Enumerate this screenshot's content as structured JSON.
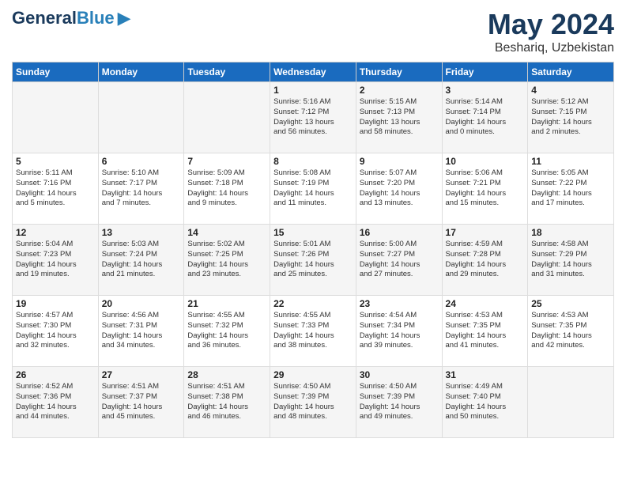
{
  "header": {
    "logo_line1": "General",
    "logo_line2": "Blue",
    "month_year": "May 2024",
    "location": "Beshariq, Uzbekistan"
  },
  "days_of_week": [
    "Sunday",
    "Monday",
    "Tuesday",
    "Wednesday",
    "Thursday",
    "Friday",
    "Saturday"
  ],
  "weeks": [
    [
      {
        "day": "",
        "content": ""
      },
      {
        "day": "",
        "content": ""
      },
      {
        "day": "",
        "content": ""
      },
      {
        "day": "1",
        "content": "Sunrise: 5:16 AM\nSunset: 7:12 PM\nDaylight: 13 hours\nand 56 minutes."
      },
      {
        "day": "2",
        "content": "Sunrise: 5:15 AM\nSunset: 7:13 PM\nDaylight: 13 hours\nand 58 minutes."
      },
      {
        "day": "3",
        "content": "Sunrise: 5:14 AM\nSunset: 7:14 PM\nDaylight: 14 hours\nand 0 minutes."
      },
      {
        "day": "4",
        "content": "Sunrise: 5:12 AM\nSunset: 7:15 PM\nDaylight: 14 hours\nand 2 minutes."
      }
    ],
    [
      {
        "day": "5",
        "content": "Sunrise: 5:11 AM\nSunset: 7:16 PM\nDaylight: 14 hours\nand 5 minutes."
      },
      {
        "day": "6",
        "content": "Sunrise: 5:10 AM\nSunset: 7:17 PM\nDaylight: 14 hours\nand 7 minutes."
      },
      {
        "day": "7",
        "content": "Sunrise: 5:09 AM\nSunset: 7:18 PM\nDaylight: 14 hours\nand 9 minutes."
      },
      {
        "day": "8",
        "content": "Sunrise: 5:08 AM\nSunset: 7:19 PM\nDaylight: 14 hours\nand 11 minutes."
      },
      {
        "day": "9",
        "content": "Sunrise: 5:07 AM\nSunset: 7:20 PM\nDaylight: 14 hours\nand 13 minutes."
      },
      {
        "day": "10",
        "content": "Sunrise: 5:06 AM\nSunset: 7:21 PM\nDaylight: 14 hours\nand 15 minutes."
      },
      {
        "day": "11",
        "content": "Sunrise: 5:05 AM\nSunset: 7:22 PM\nDaylight: 14 hours\nand 17 minutes."
      }
    ],
    [
      {
        "day": "12",
        "content": "Sunrise: 5:04 AM\nSunset: 7:23 PM\nDaylight: 14 hours\nand 19 minutes."
      },
      {
        "day": "13",
        "content": "Sunrise: 5:03 AM\nSunset: 7:24 PM\nDaylight: 14 hours\nand 21 minutes."
      },
      {
        "day": "14",
        "content": "Sunrise: 5:02 AM\nSunset: 7:25 PM\nDaylight: 14 hours\nand 23 minutes."
      },
      {
        "day": "15",
        "content": "Sunrise: 5:01 AM\nSunset: 7:26 PM\nDaylight: 14 hours\nand 25 minutes."
      },
      {
        "day": "16",
        "content": "Sunrise: 5:00 AM\nSunset: 7:27 PM\nDaylight: 14 hours\nand 27 minutes."
      },
      {
        "day": "17",
        "content": "Sunrise: 4:59 AM\nSunset: 7:28 PM\nDaylight: 14 hours\nand 29 minutes."
      },
      {
        "day": "18",
        "content": "Sunrise: 4:58 AM\nSunset: 7:29 PM\nDaylight: 14 hours\nand 31 minutes."
      }
    ],
    [
      {
        "day": "19",
        "content": "Sunrise: 4:57 AM\nSunset: 7:30 PM\nDaylight: 14 hours\nand 32 minutes."
      },
      {
        "day": "20",
        "content": "Sunrise: 4:56 AM\nSunset: 7:31 PM\nDaylight: 14 hours\nand 34 minutes."
      },
      {
        "day": "21",
        "content": "Sunrise: 4:55 AM\nSunset: 7:32 PM\nDaylight: 14 hours\nand 36 minutes."
      },
      {
        "day": "22",
        "content": "Sunrise: 4:55 AM\nSunset: 7:33 PM\nDaylight: 14 hours\nand 38 minutes."
      },
      {
        "day": "23",
        "content": "Sunrise: 4:54 AM\nSunset: 7:34 PM\nDaylight: 14 hours\nand 39 minutes."
      },
      {
        "day": "24",
        "content": "Sunrise: 4:53 AM\nSunset: 7:35 PM\nDaylight: 14 hours\nand 41 minutes."
      },
      {
        "day": "25",
        "content": "Sunrise: 4:53 AM\nSunset: 7:35 PM\nDaylight: 14 hours\nand 42 minutes."
      }
    ],
    [
      {
        "day": "26",
        "content": "Sunrise: 4:52 AM\nSunset: 7:36 PM\nDaylight: 14 hours\nand 44 minutes."
      },
      {
        "day": "27",
        "content": "Sunrise: 4:51 AM\nSunset: 7:37 PM\nDaylight: 14 hours\nand 45 minutes."
      },
      {
        "day": "28",
        "content": "Sunrise: 4:51 AM\nSunset: 7:38 PM\nDaylight: 14 hours\nand 46 minutes."
      },
      {
        "day": "29",
        "content": "Sunrise: 4:50 AM\nSunset: 7:39 PM\nDaylight: 14 hours\nand 48 minutes."
      },
      {
        "day": "30",
        "content": "Sunrise: 4:50 AM\nSunset: 7:39 PM\nDaylight: 14 hours\nand 49 minutes."
      },
      {
        "day": "31",
        "content": "Sunrise: 4:49 AM\nSunset: 7:40 PM\nDaylight: 14 hours\nand 50 minutes."
      },
      {
        "day": "",
        "content": ""
      }
    ]
  ]
}
